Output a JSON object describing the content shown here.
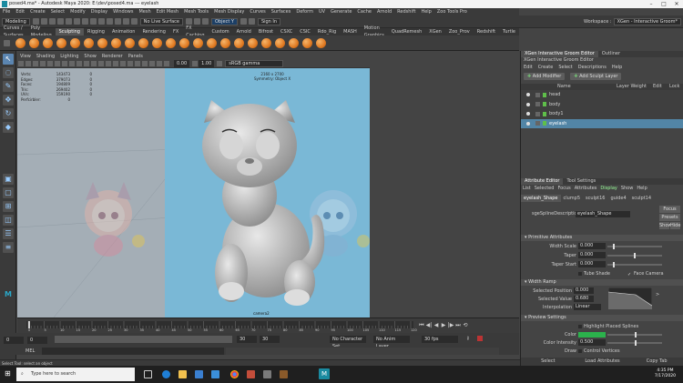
{
  "titlebar": {
    "title": "posed4.ma* - Autodesk Maya 2020: E:\\dev\\posed4.ma   ---   eyelash"
  },
  "menubar": {
    "items": [
      "File",
      "Edit",
      "Create",
      "Select",
      "Modify",
      "Display",
      "Windows",
      "Mesh",
      "Edit Mesh",
      "Mesh Tools",
      "Mesh Display",
      "Curves",
      "Surfaces",
      "Deform",
      "UV",
      "Generate",
      "Cache",
      "Arnold",
      "Redshift",
      "Help",
      "Zoo Tools Pro"
    ]
  },
  "statusline": {
    "mode": "Modeling",
    "live_surface": "No Live Surface",
    "object_field": "Object Y",
    "sign_in": "Sign In",
    "workspace": "Workspace :",
    "workspace_value": "XGen - Interactive Groom*"
  },
  "shelftabs": {
    "items": [
      "Curves / Surfaces",
      "Poly Modeling",
      "Sculpting",
      "Rigging",
      "Animation",
      "Rendering",
      "FX",
      "FX Caching",
      "Custom",
      "Arnold",
      "Bifrost",
      "CSXC",
      "CSIC",
      "Rdo_Rig",
      "MASH",
      "Motion Graphics",
      "QuadRemesh",
      "XGen",
      "Zoo_Prov",
      "Redshift",
      "Turtle"
    ],
    "active": "Sculpting"
  },
  "panel": {
    "menu": [
      "View",
      "Shading",
      "Lighting",
      "Show",
      "Renderer",
      "Panels"
    ],
    "gamma": "sRGB gamma",
    "exposure": "0.00",
    "gamma_value": "1.00"
  },
  "hud": {
    "rows": [
      [
        "Verts:",
        "143473",
        "0"
      ],
      [
        "Edges:",
        "379073",
        "0"
      ],
      [
        "Faces:",
        "194809",
        "0"
      ],
      [
        "Tris:",
        "269402",
        "0"
      ],
      [
        "UVs:",
        "159190",
        "0"
      ],
      [
        "Perfcirbler:",
        "0",
        ""
      ]
    ]
  },
  "viewport": {
    "resolution": "2160 x 2700",
    "subdiv": "Symmetry: Object X",
    "camera": "camera2"
  },
  "timeline": {
    "current": "0",
    "ticks": [
      "0",
      "5",
      "10",
      "15",
      "20",
      "25",
      "30",
      "35",
      "40",
      "45",
      "50",
      "55",
      "60",
      "65",
      "70",
      "75",
      "80",
      "85",
      "90",
      "95",
      "100",
      "105",
      "110",
      "115",
      "120"
    ]
  },
  "range": {
    "start": "0",
    "start2": "0",
    "end": "30",
    "end2": "30",
    "char_set": "No Character Set",
    "anim_layer": "No Anim Layer",
    "fps": "30 fps"
  },
  "mel": {
    "label": "MEL"
  },
  "helpline": {
    "text": "Select Tool: select an object"
  },
  "right": {
    "tabs": [
      "XGen Interactive Groom Editor",
      "Outliner"
    ],
    "xgen_menu": [
      "Edit",
      "Create",
      "Select",
      "Descriptions",
      "Help"
    ],
    "add_modifier": "Add Modifier",
    "add_sculpt": "Add Sculpt Layer",
    "outliner_header": {
      "name": "Name",
      "layer_weight": "Layer Weight",
      "edit": "Edit",
      "lock": "Lock"
    },
    "outliner_items": [
      "head",
      "body",
      "body1",
      "eyelash"
    ],
    "attr_tabs": [
      "Attribute Editor",
      "Tool Settings"
    ],
    "ae_menu": [
      "List",
      "Selected",
      "Focus",
      "Attributes",
      "Display",
      "Show",
      "Help"
    ],
    "node_tabs": [
      "eyelash_Shape",
      "clump5",
      "sculpt16",
      "guide4",
      "sculpt14"
    ],
    "spline_label": "sgeSplineDescription:",
    "spline_value": "eyelash_Shape",
    "side_btns": [
      "Focus",
      "Presets",
      "Show",
      "Hide"
    ],
    "sections": {
      "primitive": "Primitive Attributes",
      "width_ramp": "Width Ramp",
      "preview": "Preview Settings"
    },
    "primitive": {
      "width_scale": {
        "label": "Width Scale",
        "value": "0.000",
        "level": 0.1
      },
      "taper": {
        "label": "Taper",
        "value": "0.000",
        "level": 0.5
      },
      "taper_start": {
        "label": "Taper Start",
        "value": "0.000",
        "level": 0.1
      },
      "tube_shade": "Tube Shade",
      "face_camera": "Face Camera"
    },
    "ramp": {
      "pos_label": "Selected Position",
      "pos_value": "0.000",
      "val_label": "Selected Value",
      "val_value": "0.680",
      "interp_label": "Interpolation",
      "interp_value": "Linear"
    },
    "preview": {
      "highlight": "Highlight Placed Splines",
      "color_label": "Color",
      "intensity_label": "Color Intensity",
      "intensity_value": "0.500",
      "draw_label": "Draw",
      "control_vertices": "Control Vertices"
    },
    "bottom": [
      "Select",
      "Load Attributes",
      "Copy Tab"
    ]
  },
  "taskbar": {
    "search": "Type here to search",
    "time": "4:35 PM",
    "date": "7/17/2020"
  },
  "colors": {
    "accent": "#5285a6",
    "viewport_bg": "#a4aeb6",
    "camera_gate": "#7ab8d6"
  }
}
